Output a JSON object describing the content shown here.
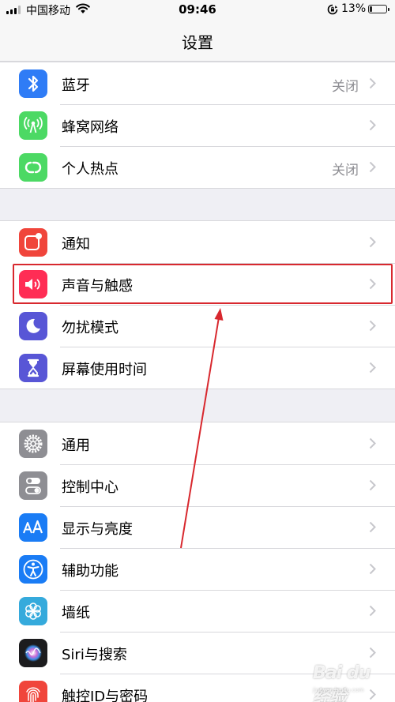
{
  "status_bar": {
    "carrier": "中国移动",
    "time": "09:46",
    "battery_percent": "13%",
    "battery_level": 0.13
  },
  "nav": {
    "title": "设置"
  },
  "groups": [
    {
      "items": [
        {
          "label": "蓝牙",
          "value": "关闭",
          "icon": "bluetooth-icon",
          "color": "#2f7cf6"
        },
        {
          "label": "蜂窝网络",
          "value": "",
          "icon": "cellular-icon",
          "color": "#4cd964"
        },
        {
          "label": "个人热点",
          "value": "关闭",
          "icon": "hotspot-icon",
          "color": "#4cd964"
        }
      ]
    },
    {
      "items": [
        {
          "label": "通知",
          "value": "",
          "icon": "notifications-icon",
          "color": "#f0453b"
        },
        {
          "label": "声音与触感",
          "value": "",
          "icon": "sound-icon",
          "color": "#ff2d55"
        },
        {
          "label": "勿扰模式",
          "value": "",
          "icon": "moon-icon",
          "color": "#5856d6"
        },
        {
          "label": "屏幕使用时间",
          "value": "",
          "icon": "hourglass-icon",
          "color": "#5856d6"
        }
      ]
    },
    {
      "items": [
        {
          "label": "通用",
          "value": "",
          "icon": "gear-icon",
          "color": "#8e8e93"
        },
        {
          "label": "控制中心",
          "value": "",
          "icon": "switches-icon",
          "color": "#8e8e93"
        },
        {
          "label": "显示与亮度",
          "value": "",
          "icon": "text-size-icon",
          "color": "#1a7cf5"
        },
        {
          "label": "辅助功能",
          "value": "",
          "icon": "accessibility-icon",
          "color": "#1a7cf5"
        },
        {
          "label": "墙纸",
          "value": "",
          "icon": "flower-icon",
          "color": "#35aadc"
        },
        {
          "label": "Siri与搜索",
          "value": "",
          "icon": "siri-icon",
          "color": "#1c1c1e"
        },
        {
          "label": "触控ID与密码",
          "value": "",
          "icon": "fingerprint-icon",
          "color": "#f0453b"
        }
      ]
    }
  ],
  "watermark": {
    "text": "Bai du 经验",
    "sub": "jingyan.baidu.com"
  },
  "colors": {
    "background": "#efeff4",
    "annotation": "#d8282e",
    "chevron": "#c7c7cc",
    "secondary_text": "#8e8e93"
  }
}
